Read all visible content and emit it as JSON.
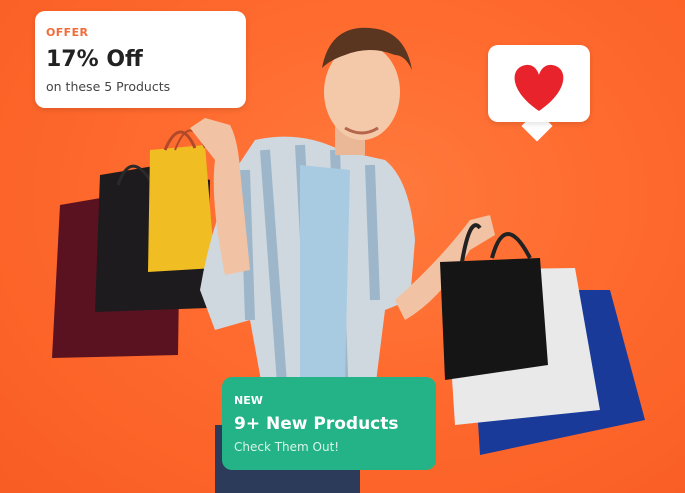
{
  "offer_card": {
    "tag": "OFFER",
    "title": "17% Off",
    "subtitle": "on these 5 Products"
  },
  "heart_bubble": {
    "icon": "heart-icon",
    "color": "#e8232b"
  },
  "new_card": {
    "tag": "NEW",
    "title": "9+ New Products",
    "subtitle": "Check Them Out!"
  },
  "colors": {
    "background": "#ff6a2e",
    "accent_green": "#23b386",
    "offer_text": "#f26b3a"
  }
}
